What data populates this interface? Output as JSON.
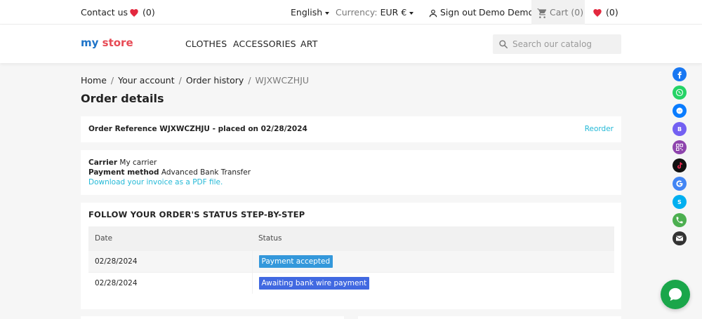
{
  "topbar": {
    "contact_label": "Contact us",
    "wishlist_count_left": "(0)",
    "language_label": "English",
    "currency_label": "Currency:",
    "currency_value": "EUR €",
    "signout_label": "Sign out",
    "user_name": "Demo Demo",
    "cart_label": "Cart",
    "cart_count": "(0)",
    "wishlist_count_right": "(0)"
  },
  "header": {
    "logo_part1": "my",
    "logo_part2": "store",
    "menu": [
      "CLOTHES",
      "ACCESSORIES",
      "ART"
    ],
    "search_placeholder": "Search our catalog"
  },
  "breadcrumb": [
    "Home",
    "Your account",
    "Order history",
    "WJXWCZHJU"
  ],
  "page_title": "Order details",
  "order": {
    "reference_text": "Order Reference WJXWCZHJU - placed on 02/28/2024",
    "reorder_label": "Reorder",
    "carrier_label": "Carrier",
    "carrier_value": "My carrier",
    "payment_label": "Payment method",
    "payment_value": "Advanced Bank Transfer",
    "invoice_link": "Download your invoice as a PDF file."
  },
  "status_section": {
    "heading": "FOLLOW YOUR ORDER'S STATUS STEP-BY-STEP",
    "col_date": "Date",
    "col_status": "Status",
    "rows": [
      {
        "date": "02/28/2024",
        "status": "Payment accepted",
        "color": "#3498db"
      },
      {
        "date": "02/28/2024",
        "status": "Awaiting bank wire payment",
        "color": "#4169e1"
      }
    ]
  },
  "colors": {
    "accent_link": "#24b9d7",
    "heart": "#e3283e",
    "chat": "#1aa64a"
  },
  "social_icons": [
    {
      "name": "facebook-icon",
      "color": "#1877f2"
    },
    {
      "name": "whatsapp-icon",
      "color": "#25d366"
    },
    {
      "name": "messenger-icon",
      "color": "#0a7cff"
    },
    {
      "name": "viber-icon",
      "color": "#7360f2"
    },
    {
      "name": "qr-icon",
      "color": "#8e44ad"
    },
    {
      "name": "tiktok-icon",
      "color": "#111111"
    },
    {
      "name": "google-icon",
      "color": "#4285f4"
    },
    {
      "name": "skype-icon",
      "color": "#00aff0"
    },
    {
      "name": "phone-icon",
      "color": "#4caf50"
    },
    {
      "name": "email-icon",
      "color": "#333333"
    }
  ]
}
